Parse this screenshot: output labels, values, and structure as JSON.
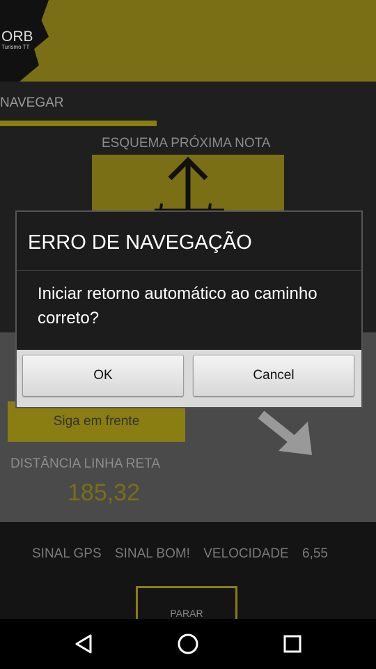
{
  "header": {
    "logo_main": "ORB",
    "logo_sub": "Turismo TT"
  },
  "screen": {
    "nav_title": "NAVEGAR",
    "schema_label": "ESQUEMA PRÓXIMA NOTA",
    "direction": "Siga em frente",
    "distance_label": "DISTÂNCIA LINHA RETA",
    "distance_value": "185,32",
    "gps_label": "SINAL GPS",
    "gps_status": "SINAL BOM!",
    "speed_label": "VELOCIDADE",
    "speed_value": "6,55",
    "stop_button": "PARAR"
  },
  "dialog": {
    "title": "ERRO DE NAVEGAÇÃO",
    "message": "Iniciar retorno automático ao caminho correto?",
    "ok_label": "OK",
    "cancel_label": "Cancel"
  },
  "system_nav": {
    "back": "back-icon",
    "home": "home-icon",
    "recents": "recents-icon"
  },
  "colors": {
    "accent": "#8a7d12",
    "dialog_bg": "#1c1c1c"
  }
}
